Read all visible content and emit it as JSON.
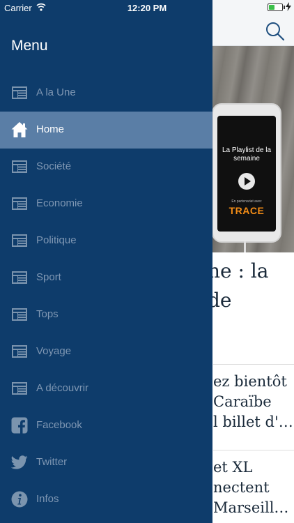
{
  "status_bar": {
    "carrier": "Carrier",
    "time": "12:20 PM",
    "battery_level": 0.45
  },
  "drawer": {
    "title": "Menu",
    "items": [
      {
        "label": "A la Une",
        "icon": "newspaper-icon",
        "active": false
      },
      {
        "label": "Home",
        "icon": "home-icon",
        "active": true
      },
      {
        "label": "Société",
        "icon": "newspaper-icon",
        "active": false
      },
      {
        "label": "Economie",
        "icon": "newspaper-icon",
        "active": false
      },
      {
        "label": "Politique",
        "icon": "newspaper-icon",
        "active": false
      },
      {
        "label": "Sport",
        "icon": "newspaper-icon",
        "active": false
      },
      {
        "label": "Tops",
        "icon": "newspaper-icon",
        "active": false
      },
      {
        "label": "Voyage",
        "icon": "newspaper-icon",
        "active": false
      },
      {
        "label": "A découvrir",
        "icon": "newspaper-icon",
        "active": false
      },
      {
        "label": "Facebook",
        "icon": "facebook-icon",
        "active": false
      },
      {
        "label": "Twitter",
        "icon": "twitter-icon",
        "active": false
      },
      {
        "label": "Infos",
        "icon": "info-icon",
        "active": false
      }
    ]
  },
  "background": {
    "hero": {
      "screen_title": "La Playlist de la semaine",
      "partner_text": "En partenariat avec",
      "brand": "TRACE"
    },
    "headline": [
      "ne : la",
      "de"
    ],
    "articles": [
      {
        "lines": [
          "ez bientôt",
          "Caraïbe",
          "l billet d'…"
        ]
      },
      {
        "lines": [
          "et XL",
          "nectent",
          "Marseill…"
        ]
      }
    ]
  },
  "colors": {
    "drawer_bg": "#0e3c6b",
    "active_item_bg": "#5a7ea6",
    "inactive_label": "#7f97b3"
  }
}
